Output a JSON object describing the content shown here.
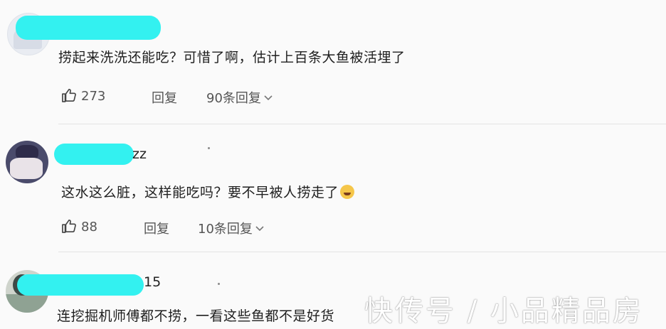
{
  "comments": [
    {
      "username_tail": "",
      "text": "捞起来洗洗还能吃？可惜了啊，估计上百条大鱼被活埋了",
      "likes": "273",
      "reply_label": "回复",
      "replies_label": "90条回复"
    },
    {
      "username_tail": "zz",
      "text": "这水这么脏，这样能吃吗？要不早被人捞走了",
      "emoji": "grinning-sweat-emoji",
      "likes": "88",
      "reply_label": "回复",
      "replies_label": "10条回复"
    },
    {
      "username_tail": "15",
      "text": "连挖掘机师傅都不捞，一看这些鱼都不是好货"
    }
  ],
  "watermark": "快传号 / 小品精品房",
  "colors": {
    "redaction": "#33f1f0",
    "background": "#fafafa"
  }
}
